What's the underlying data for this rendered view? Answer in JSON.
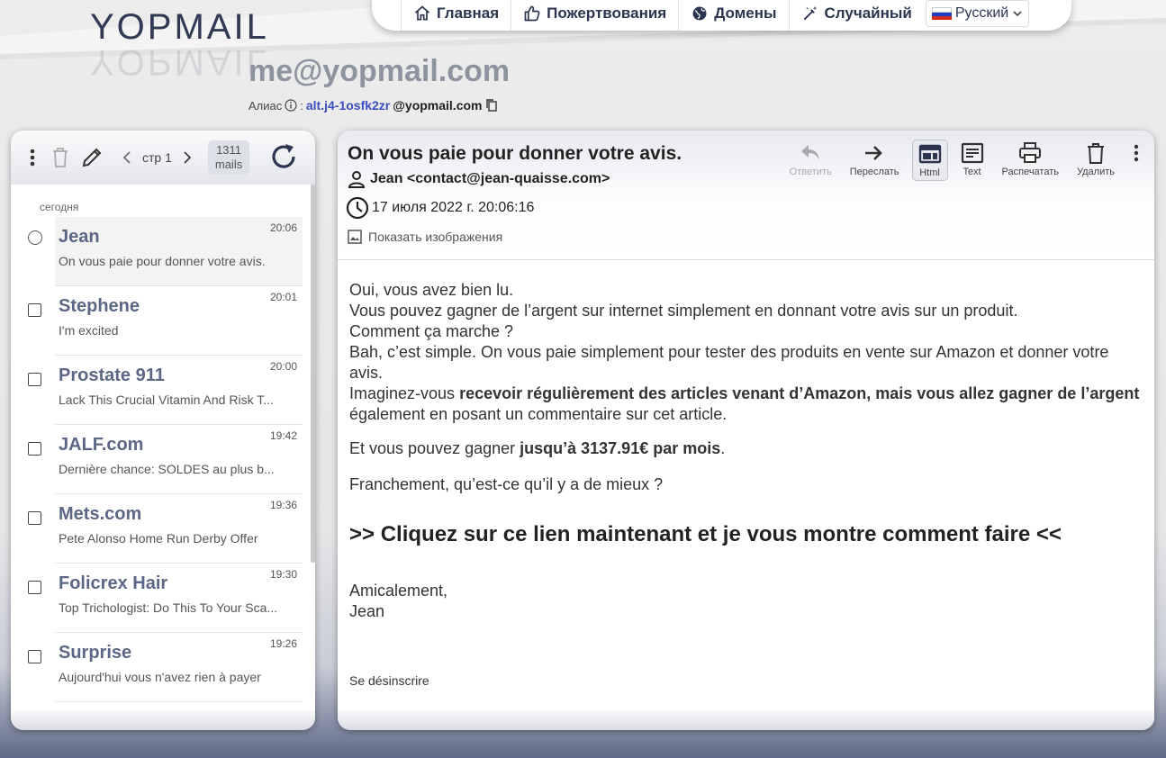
{
  "logo": {
    "text": "YOPMAIL"
  },
  "nav": {
    "home": "Главная",
    "donate": "Пожертвования",
    "domains": "Домены",
    "random": "Случайный",
    "language": "Русский"
  },
  "address": "me@yopmail.com",
  "alias": {
    "label": "Алиас",
    "separator": ":",
    "id": "alt.j4-1osfk2zr",
    "domain": "@yopmail.com"
  },
  "inbox": {
    "page": "стр 1",
    "count": "1311",
    "count_unit": "mails",
    "day_label": "сегодня",
    "mails": [
      {
        "from": "Jean",
        "time": "20:06",
        "subject": "On vous paie pour donner votre avis."
      },
      {
        "from": "Stephene",
        "time": "20:01",
        "subject": "I'm excited"
      },
      {
        "from": "Prostate 911",
        "time": "20:00",
        "subject": "Lack This Crucial Vitamin And Risk T..."
      },
      {
        "from": "JALF.com",
        "time": "19:42",
        "subject": "Dernière chance: SOLDES au plus b..."
      },
      {
        "from": "Mets.com",
        "time": "19:36",
        "subject": "Pete Alonso Home Run Derby Offer"
      },
      {
        "from": "Folicrex Hair",
        "time": "19:30",
        "subject": "Top Trichologist: Do This To Your Sca..."
      },
      {
        "from": "Surprise",
        "time": "19:26",
        "subject": "Aujourd'hui vous n'avez rien à payer"
      }
    ]
  },
  "message": {
    "subject": "On vous paie pour donner votre avis.",
    "from": "Jean <contact@jean-quaisse.com>",
    "date": "17 июля 2022 г. 20:06:16",
    "show_images": "Показать изображения",
    "actions": {
      "reply": "Ответить",
      "forward": "Переслать",
      "html": "Html",
      "text": "Text",
      "print": "Распечатать",
      "delete": "Удалить"
    },
    "body": {
      "l1": "Oui, vous avez bien lu.",
      "l2": "Vous pouvez gagner de l’argent sur internet simplement en donnant votre avis sur un produit.",
      "l3": "Comment ça marche ?",
      "l4": "Bah, c’est simple. On vous paie simplement pour tester des produits en vente sur Amazon et donner votre avis.",
      "l5a": "Imaginez-vous ",
      "l5b": "recevoir régulièrement des articles venant d’Amazon, mais vous allez gagner de l’argent",
      "l5c": " également en posant un commentaire sur cet article.",
      "l6a": "Et vous pouvez gagner ",
      "l6b": "jusqu’à 3137.91€ par mois",
      "l6c": ".",
      "l7": "Franchement, qu’est-ce qu’il y a de mieux ?",
      "cta": ">> Cliquez sur ce lien maintenant et je vous montre comment faire <<",
      "sig1": "Amicalement,",
      "sig2": "Jean",
      "unsubscribe": "Se désinscrire"
    }
  },
  "colors": {
    "accent": "#2b3550",
    "alias_link": "#3b4fc0",
    "sender": "#5b6784"
  }
}
